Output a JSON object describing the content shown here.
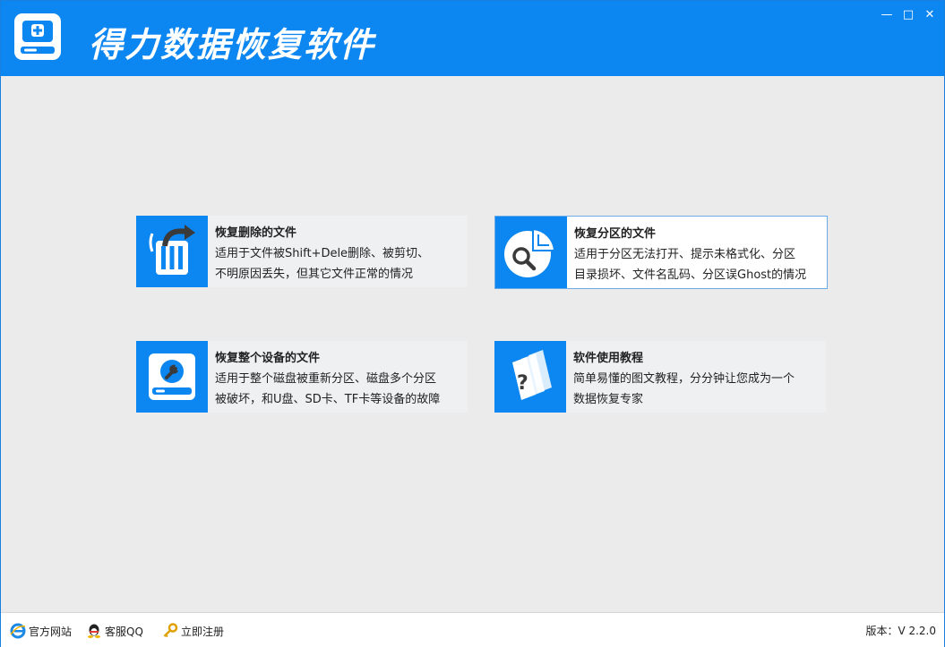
{
  "app": {
    "title": "得力数据恢复软件",
    "minimize_glyph": "—",
    "maximize_glyph": "□",
    "close_glyph": "✕"
  },
  "cards": [
    {
      "title": "恢复删除的文件",
      "line1": "适用于文件被Shift+Dele删除、被剪切、",
      "line2": "不明原因丢失，但其它文件正常的情况",
      "icon": "trash-restore-icon"
    },
    {
      "title": "恢复分区的文件",
      "line1": "适用于分区无法打开、提示未格式化、分区",
      "line2": "目录损坏、文件名乱码、分区误Ghost的情况",
      "icon": "partition-search-icon"
    },
    {
      "title": "恢复整个设备的文件",
      "line1": "适用于整个磁盘被重新分区、磁盘多个分区",
      "line2": "被破坏，和U盘、SD卡、TF卡等设备的故障",
      "icon": "disk-repair-icon"
    },
    {
      "title": "软件使用教程",
      "line1": "简单易懂的图文教程，分分钟让您成为一个",
      "line2": "数据恢复专家",
      "icon": "tutorial-book-icon"
    }
  ],
  "footer": {
    "website": "官方网站",
    "qq": "客服QQ",
    "register": "立即注册",
    "version": "版本：V 2.2.0"
  },
  "colors": {
    "accent": "#0c86f0",
    "background": "#ebebeb",
    "card_bg": "#eef0f2"
  }
}
